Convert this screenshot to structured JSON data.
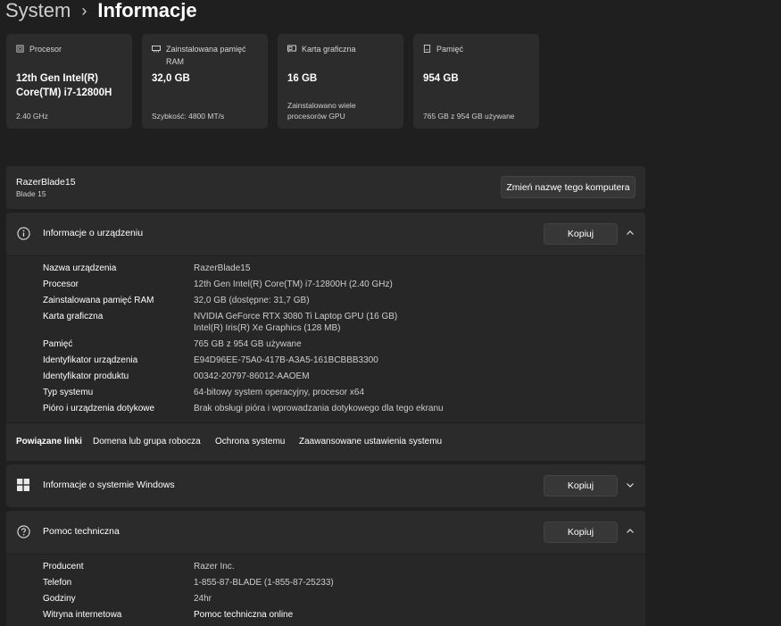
{
  "breadcrumb": {
    "parent": "System",
    "separator": "›",
    "current": "Informacje"
  },
  "specs": [
    {
      "caption": "Procesor",
      "value": "12th Gen Intel(R) Core(TM) i7-12800H",
      "sub": "2.40 GHz",
      "icon": "processor-icon"
    },
    {
      "caption": "Zainstalowana pamięć RAM",
      "value": "32,0 GB",
      "sub": "Szybkość: 4800 MT/s",
      "icon": "ram-icon"
    },
    {
      "caption": "Karta graficzna",
      "value": "16 GB",
      "sub": "Zainstalowano wiele procesorów GPU",
      "icon": "graphics-card-icon"
    },
    {
      "caption": "Pamięć",
      "value": "954 GB",
      "sub": "765 GB z 954 GB używane",
      "icon": "storage-icon"
    }
  ],
  "pc": {
    "name": "RazerBlade15",
    "model": "Blade 15",
    "rename_label": "Zmień nazwę tego komputera"
  },
  "device_info": {
    "title": "Informacje o urządzeniu",
    "copy_label": "Kopiuj",
    "rows": [
      {
        "label": "Nazwa urządzenia",
        "value": "RazerBlade15"
      },
      {
        "label": "Procesor",
        "value": "12th Gen Intel(R) Core(TM) i7-12800H (2.40 GHz)"
      },
      {
        "label": "Zainstalowana pamięć RAM",
        "value": "32,0 GB (dostępne: 31,7 GB)"
      },
      {
        "label": "Karta graficzna",
        "value": "NVIDIA GeForce RTX 3080 Ti Laptop GPU (16 GB)",
        "value2": "Intel(R) Iris(R) Xe Graphics (128 MB)"
      },
      {
        "label": "Pamięć",
        "value": "765 GB z 954 GB używane"
      },
      {
        "label": "Identyfikator urządzenia",
        "value": "E94D96EE-75A0-417B-A3A5-161BCBBB3300"
      },
      {
        "label": "Identyfikator produktu",
        "value": "00342-20797-86012-AAOEM"
      },
      {
        "label": "Typ systemu",
        "value": "64-bitowy system operacyjny, procesor x64"
      },
      {
        "label": "Pióro i urządzenia dotykowe",
        "value": "Brak obsługi pióra i wprowadzania dotykowego dla tego ekranu"
      }
    ]
  },
  "related_links": {
    "title": "Powiązane linki",
    "items": [
      "Domena lub grupa robocza",
      "Ochrona systemu",
      "Zaawansowane ustawienia systemu"
    ]
  },
  "windows_info": {
    "title": "Informacje o systemie Windows",
    "copy_label": "Kopiuj"
  },
  "support": {
    "title": "Pomoc techniczna",
    "copy_label": "Kopiuj",
    "rows": [
      {
        "label": "Producent",
        "value": "Razer Inc."
      },
      {
        "label": "Telefon",
        "value": "1-855-87-BLADE (1-855-87-25233)"
      },
      {
        "label": "Godziny",
        "value": "24hr"
      },
      {
        "label": "Witryna internetowa",
        "value": "Pomoc techniczna online"
      }
    ]
  }
}
